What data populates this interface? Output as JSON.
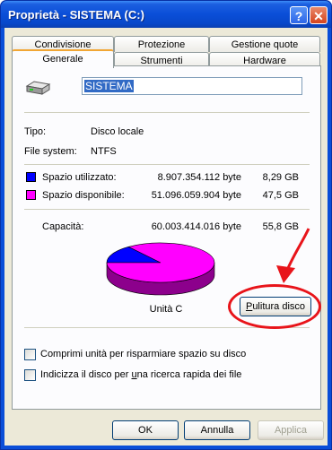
{
  "window": {
    "title": "Proprietà - SISTEMA (C:)",
    "help": "?",
    "close": "✕"
  },
  "tabs_back": [
    "Condivisione",
    "Protezione",
    "Gestione quote"
  ],
  "tabs_front": [
    "Generale",
    "Strumenti",
    "Hardware"
  ],
  "general": {
    "drive_name": "SISTEMA",
    "type_label": "Tipo:",
    "type_value": "Disco locale",
    "fs_label": "File system:",
    "fs_value": "NTFS",
    "used_label": "Spazio utilizzato:",
    "used_bytes": "8.907.354.112 byte",
    "used_gb": "8,29 GB",
    "used_color": "#0000ff",
    "free_label": "Spazio disponibile:",
    "free_bytes": "51.096.059.904 byte",
    "free_gb": "47,5 GB",
    "free_color": "#ff00ff",
    "capacity_label": "Capacità:",
    "capacity_bytes": "60.003.414.016 byte",
    "capacity_gb": "55,8 GB",
    "drive_label": "Unità C",
    "cleanup_button": "Pulitura disco",
    "compress_label": "Comprimi unità per risparmiare spazio su disco",
    "index_label": "Indicizza il disco per una ricerca rapida dei file",
    "icon": "hard-drive-icon"
  },
  "chart_data": {
    "type": "pie",
    "values": [
      8907354112,
      51096059904
    ],
    "colors": [
      "#0000ff",
      "#ff00ff"
    ]
  },
  "buttons": {
    "ok": "OK",
    "cancel": "Annulla",
    "apply": "Applica"
  }
}
